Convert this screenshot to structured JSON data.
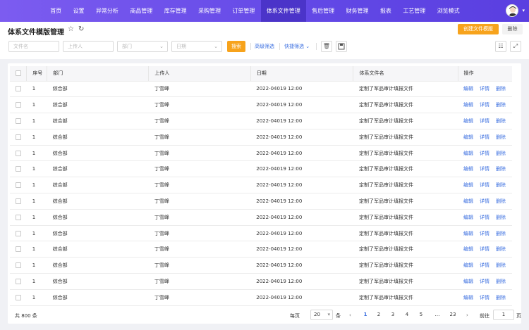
{
  "nav": {
    "items": [
      "首页",
      "设置",
      "异常分析",
      "商品管理",
      "库存管理",
      "采购管理",
      "订单管理",
      "体系文件管理",
      "售后管理",
      "财务管理",
      "报表",
      "工艺管理",
      "浏览模式"
    ],
    "active_index": 7
  },
  "header": {
    "title": "体系文件模版管理",
    "create_label": "创建文件模版",
    "delete_label": "删除"
  },
  "filters": {
    "file_name_placeholder": "文件名",
    "uploader_placeholder": "上传人",
    "department_placeholder": "部门",
    "date_placeholder": "日期",
    "search_label": "搜索",
    "advanced_label": "高级筛选",
    "quick_label": "快捷筛选"
  },
  "table": {
    "columns": [
      "序号",
      "部门",
      "上传人",
      "日期",
      "体系文件名",
      "操作"
    ],
    "row": {
      "index": "1",
      "dept": "综合部",
      "uploader": "丁雪峰",
      "date": "2022-04019 12:00",
      "file": "定制了军品审计填报文件"
    },
    "row_count": 14,
    "actions": [
      "编辑",
      "详情",
      "删除"
    ]
  },
  "pagination": {
    "total": "共 800 条",
    "per_page_label": "每页",
    "per_page_value": "20",
    "unit": "条",
    "pages": [
      "1",
      "2",
      "3",
      "4",
      "5",
      "…",
      "23"
    ],
    "current": "1",
    "goto_label": "前往",
    "goto_value": "1",
    "page_suffix": "页"
  },
  "colors": {
    "accent": "#6248e6",
    "orange": "#f7a31c",
    "link": "#3b6fe0"
  }
}
